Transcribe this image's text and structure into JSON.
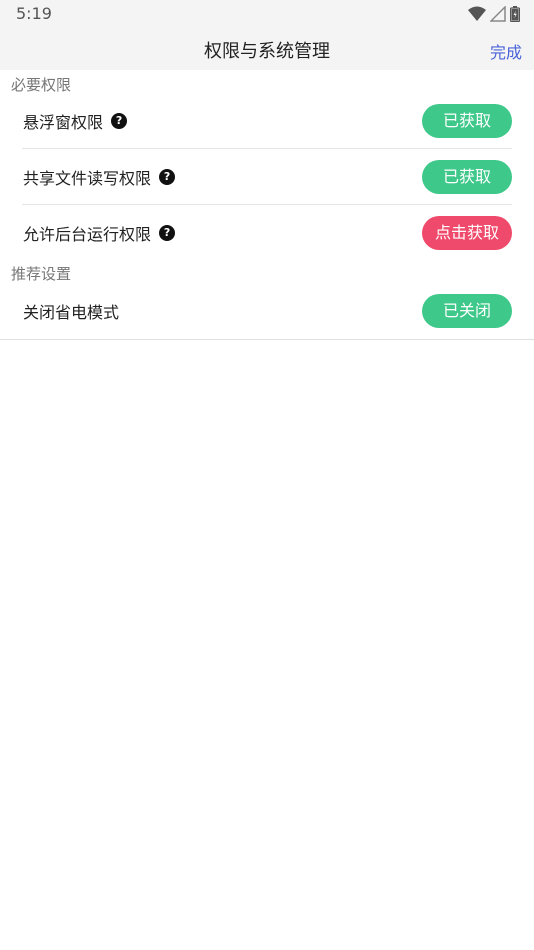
{
  "status_bar": {
    "time": "5:19",
    "icons": [
      "wifi-icon",
      "signal-icon",
      "battery-icon"
    ]
  },
  "header": {
    "title": "权限与系统管理",
    "done_label": "完成"
  },
  "colors": {
    "acquired_green": "#3ec88a",
    "action_red": "#ef4a6b",
    "accent_blue": "#4a63d9"
  },
  "sections": [
    {
      "title": "必要权限",
      "items": [
        {
          "label": "悬浮窗权限",
          "help": true,
          "button": "已获取"
        },
        {
          "label": "共享文件读写权限",
          "help": true,
          "button": "已获取"
        },
        {
          "label": "允许后台运行权限",
          "help": true,
          "button": "点击获取"
        }
      ]
    },
    {
      "title": "推荐设置",
      "items": [
        {
          "label": "关闭省电模式",
          "help": false,
          "button": "已关闭"
        }
      ]
    }
  ]
}
